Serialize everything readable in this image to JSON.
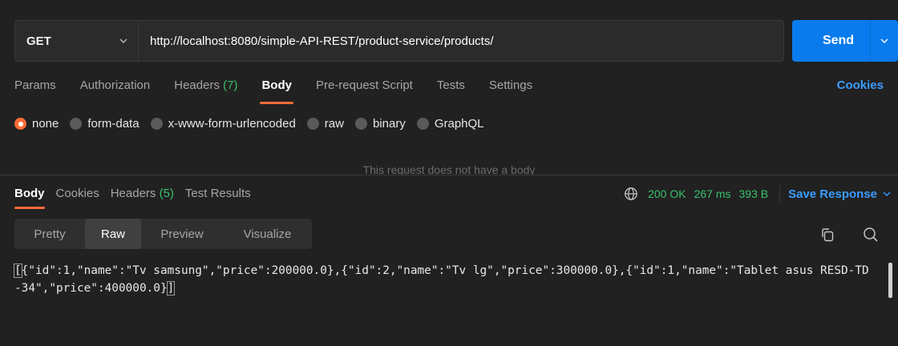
{
  "request": {
    "method": "GET",
    "url": "http://localhost:8080/simple-API-REST/product-service/products/",
    "send_label": "Send"
  },
  "request_tabs": [
    {
      "label": "Params"
    },
    {
      "label": "Authorization"
    },
    {
      "label": "Headers",
      "count": "(7)"
    },
    {
      "label": "Body"
    },
    {
      "label": "Pre-request Script"
    },
    {
      "label": "Tests"
    },
    {
      "label": "Settings"
    }
  ],
  "cookies_label": "Cookies",
  "body_types": [
    {
      "label": "none"
    },
    {
      "label": "form-data"
    },
    {
      "label": "x-www-form-urlencoded"
    },
    {
      "label": "raw"
    },
    {
      "label": "binary"
    },
    {
      "label": "GraphQL"
    }
  ],
  "no_body_message": "This request does not have a body",
  "response_tabs": [
    {
      "label": "Body"
    },
    {
      "label": "Cookies"
    },
    {
      "label": "Headers",
      "count": "(5)"
    },
    {
      "label": "Test Results"
    }
  ],
  "response_meta": {
    "status": "200 OK",
    "time": "267 ms",
    "size": "393 B",
    "save_label": "Save Response"
  },
  "view_modes": [
    {
      "label": "Pretty"
    },
    {
      "label": "Raw"
    },
    {
      "label": "Preview"
    },
    {
      "label": "Visualize"
    }
  ],
  "response_body": {
    "open": "[",
    "text": "{\"id\":1,\"name\":\"Tv samsung\",\"price\":200000.0},{\"id\":2,\"name\":\"Tv lg\",\"price\":300000.0},{\"id\":1,\"name\":\"Tablet asus RESD-TD-34\",\"price\":400000.0}",
    "close": "]"
  },
  "colors": {
    "accent": "#ff6c37",
    "send": "#097bed",
    "link": "#3b9cff",
    "success": "#39c16c",
    "background": "#212121"
  }
}
